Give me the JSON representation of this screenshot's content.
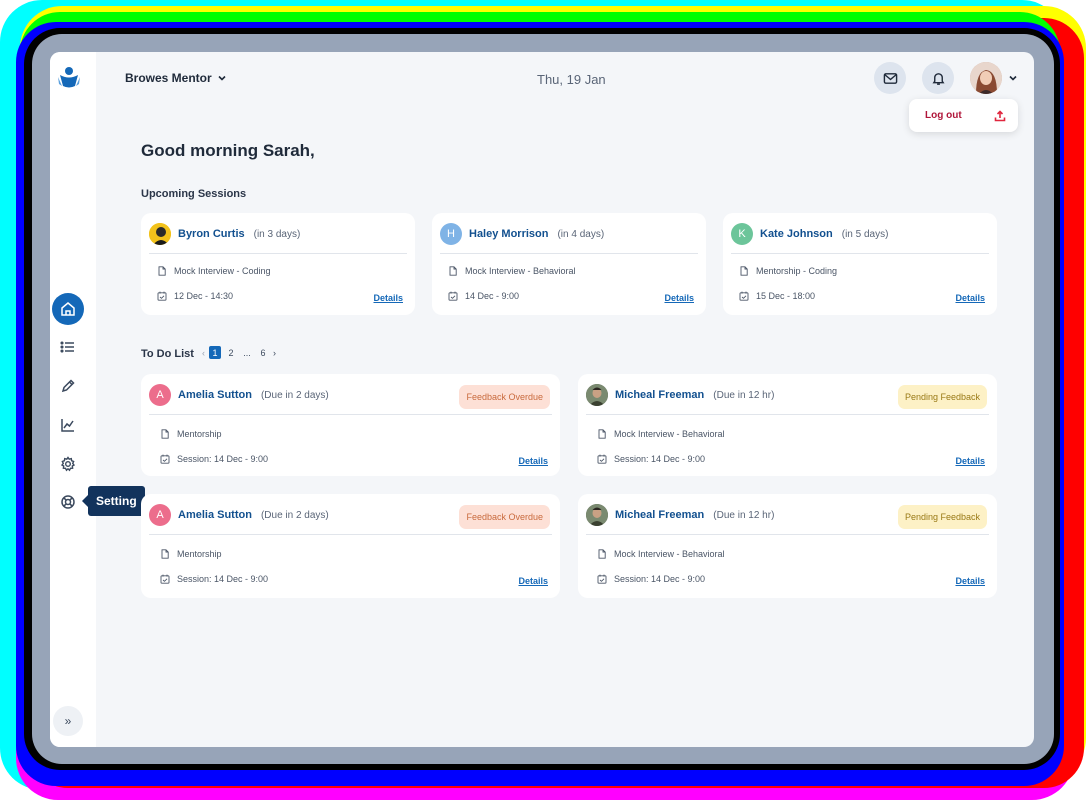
{
  "header": {
    "mentor_menu_label": "Browes Mentor",
    "date": "Thu, 19 Jan"
  },
  "user_menu": {
    "logout_label": "Log out"
  },
  "sidebar": {
    "tooltip": "Setting"
  },
  "greeting": "Good morning Sarah,",
  "upcoming": {
    "title": "Upcoming Sessions",
    "items": [
      {
        "name": "Byron Curtis",
        "when": "(in 3 days)",
        "type": "Mock Interview - Coding",
        "datetime": "12 Dec - 14:30",
        "details": "Details"
      },
      {
        "name": "Haley Morrison",
        "initial": "H",
        "when": "(in 4 days)",
        "type": "Mock Interview - Behavioral",
        "datetime": "14 Dec - 9:00",
        "details": "Details"
      },
      {
        "name": "Kate Johnson",
        "initial": "K",
        "when": "(in 5 days)",
        "type": "Mentorship - Coding",
        "datetime": "15 Dec - 18:00",
        "details": "Details"
      }
    ]
  },
  "todo": {
    "title": "To Do List",
    "pages": [
      "1",
      "2",
      "...",
      "6"
    ],
    "items": [
      {
        "name": "Amelia Sutton",
        "initial": "A",
        "due": "(Due in 2 days)",
        "status": "Feedback Overdue",
        "type": "Mentorship",
        "session": "Session: 14 Dec - 9:00",
        "details": "Details"
      },
      {
        "name": "Micheal Freeman",
        "due": "(Due in 12 hr)",
        "status": "Pending Feedback",
        "type": "Mock Interview - Behavioral",
        "session": "Session: 14 Dec - 9:00",
        "details": "Details"
      },
      {
        "name": "Amelia Sutton",
        "initial": "A",
        "due": "(Due in 2 days)",
        "status": "Feedback Overdue",
        "type": "Mentorship",
        "session": "Session: 14 Dec - 9:00",
        "details": "Details"
      },
      {
        "name": "Micheal Freeman",
        "due": "(Due in 12 hr)",
        "status": "Pending Feedback",
        "type": "Mock Interview - Behavioral",
        "session": "Session: 14 Dec - 9:00",
        "details": "Details"
      }
    ]
  },
  "colors": {
    "accent": "#1468b8",
    "overdue_bg": "#fde0d6",
    "pending_bg": "#fdf1c6"
  }
}
